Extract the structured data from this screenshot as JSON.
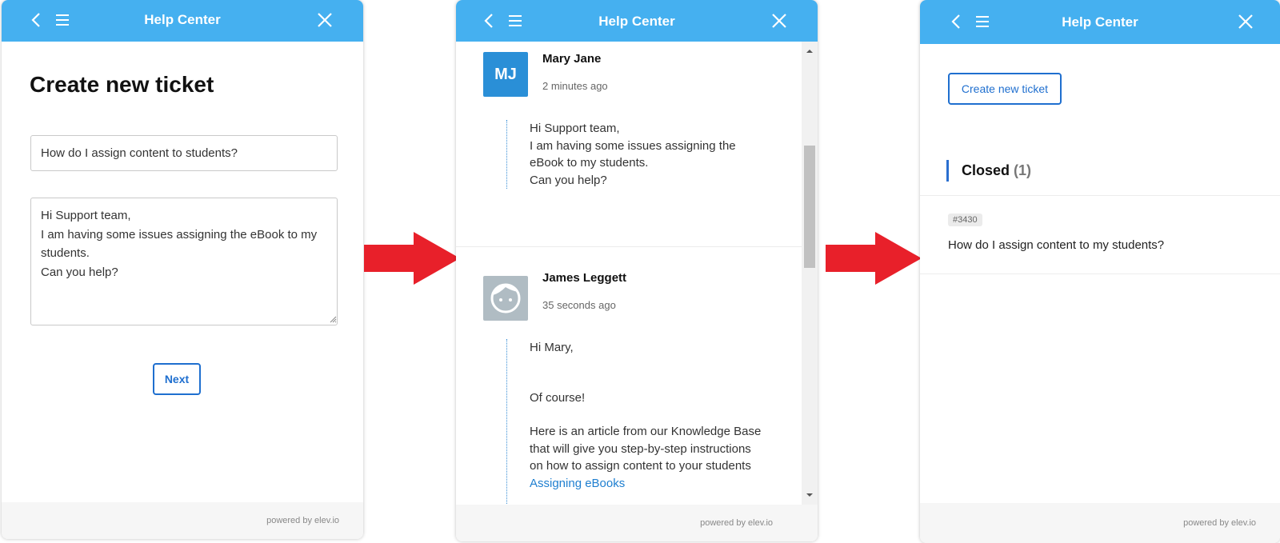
{
  "colors": {
    "header": "#45b0f0",
    "accent": "#1f6fcf",
    "arrow": "#e8202a",
    "avatar_mj": "#2a8fd7",
    "avatar_jl": "#b0bcc3"
  },
  "icons": {
    "back": "chevron-left-icon",
    "menu": "hamburger-menu-icon",
    "close": "close-icon",
    "arrow": "right-arrow-icon",
    "avatar_placeholder": "face-avatar-icon"
  },
  "panel1": {
    "header_title": "Help Center",
    "heading": "Create new ticket",
    "subject_value": "How do I assign content to students?",
    "message_value": "Hi Support team,\nI am having some issues assigning the eBook to my students.\nCan you help?",
    "next_label": "Next",
    "footer": "powered by elev.io"
  },
  "panel2": {
    "header_title": "Help Center",
    "messages": [
      {
        "initials": "MJ",
        "author": "Mary Jane",
        "time": "2 minutes ago",
        "lines": [
          "Hi Support team,",
          "I am having some issues assigning the",
          "eBook to my students.",
          "Can you help?"
        ]
      },
      {
        "author": "James Leggett",
        "time": "35 seconds ago",
        "greeting": "Hi Mary,",
        "reply": "Of course!",
        "body_lines": [
          "Here is an article from our Knowledge Base",
          "that will give you step-by-step instructions",
          "on how to assign content to your students"
        ],
        "link": "Assigning eBooks"
      }
    ],
    "footer": "powered by elev.io"
  },
  "panel3": {
    "header_title": "Help Center",
    "create_label": "Create new ticket",
    "section_label": "Closed",
    "section_count": "(1)",
    "ticket_id": "#3430",
    "ticket_title": "How do I assign content to my students?",
    "footer": "powered by elev.io"
  }
}
